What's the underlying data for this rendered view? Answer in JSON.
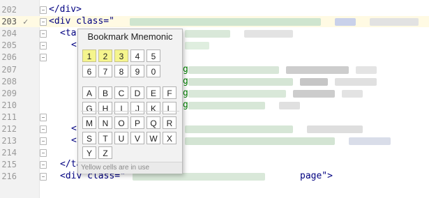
{
  "editor": {
    "lines": [
      {
        "num": "202",
        "code": "</div>"
      },
      {
        "num": "203",
        "code": "<div class=\""
      },
      {
        "num": "204",
        "code": "<ta"
      },
      {
        "num": "205",
        "code": "<"
      },
      {
        "num": "206",
        "code": ""
      },
      {
        "num": "207",
        "code": "g"
      },
      {
        "num": "208",
        "code": "g"
      },
      {
        "num": "209",
        "code": "g"
      },
      {
        "num": "210",
        "code": "g"
      },
      {
        "num": "211",
        "code": ""
      },
      {
        "num": "212",
        "code": "<"
      },
      {
        "num": "213",
        "code": "<"
      },
      {
        "num": "214",
        "code": ""
      },
      {
        "num": "215",
        "code": "</table>"
      },
      {
        "num": "216",
        "code": "<div class=\""
      }
    ],
    "line216_tail": "page\">",
    "current_line_marker": "✓"
  },
  "popup": {
    "title": "Bookmark Mnemonic",
    "digits": [
      "1",
      "2",
      "3",
      "4",
      "5",
      "6",
      "7",
      "8",
      "9",
      "0"
    ],
    "used": [
      "1",
      "2",
      "3"
    ],
    "letters": [
      "A",
      "B",
      "C",
      "D",
      "E",
      "F",
      "G",
      "H",
      "I",
      "J",
      "K",
      "L",
      "M",
      "N",
      "O",
      "P",
      "Q",
      "R",
      "S",
      "T",
      "U",
      "V",
      "W",
      "X",
      "Y",
      "Z"
    ],
    "hint": "Yellow cells are in use"
  }
}
